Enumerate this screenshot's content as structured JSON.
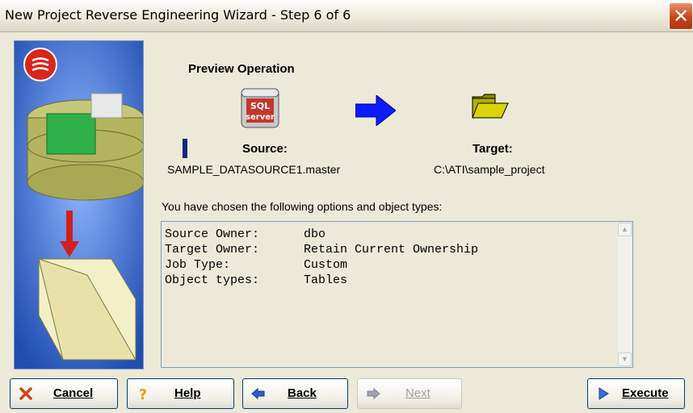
{
  "window": {
    "title": "New Project Reverse Engineering Wizard - Step 6 of 6"
  },
  "preview": {
    "title": "Preview Operation",
    "source_label": "Source:",
    "source_value": "SAMPLE_DATASOURCE1.master",
    "target_label": "Target:",
    "target_value": "C:\\ATI\\sample_project",
    "sql_icon_text_top": "SQL",
    "sql_icon_text_bottom": "server"
  },
  "options": {
    "intro": "You have chosen the following options and object types:",
    "rows": [
      {
        "key": "Source Owner:",
        "value": "dbo"
      },
      {
        "key": "Target Owner:",
        "value": "Retain Current Ownership"
      },
      {
        "key": "Job Type:",
        "value": "Custom"
      },
      {
        "key": "Object types:",
        "value": "Tables"
      }
    ]
  },
  "buttons": {
    "cancel": "Cancel",
    "help": "Help",
    "back": "Back",
    "next": "Next",
    "execute": "Execute"
  },
  "colors": {
    "accent_blue": "#0b1cff",
    "close_red": "#c8441c",
    "folder_olive": "#8c8a00"
  },
  "icons": {
    "close": "close-icon",
    "cancel": "x-icon",
    "help": "question-icon",
    "back": "back-arrow-icon",
    "next": "next-arrow-icon",
    "execute": "play-icon",
    "source": "sql-server-icon",
    "flow": "right-arrow-icon",
    "target": "folder-open-icon"
  }
}
